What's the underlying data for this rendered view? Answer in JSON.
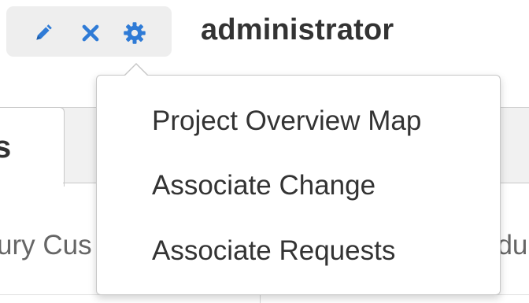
{
  "toolbar": {
    "icons": [
      "pencil-icon",
      "close-icon",
      "gear-icon"
    ],
    "icon_color": "#2f7bd6"
  },
  "header": {
    "username": "administrator"
  },
  "background": {
    "active_tab_label": "s",
    "left_text": "ury Cus",
    "right_text": "edu"
  },
  "menu": {
    "items": [
      {
        "label": "Project Overview Map"
      },
      {
        "label": "Associate Change"
      },
      {
        "label": "Associate Requests"
      }
    ]
  }
}
